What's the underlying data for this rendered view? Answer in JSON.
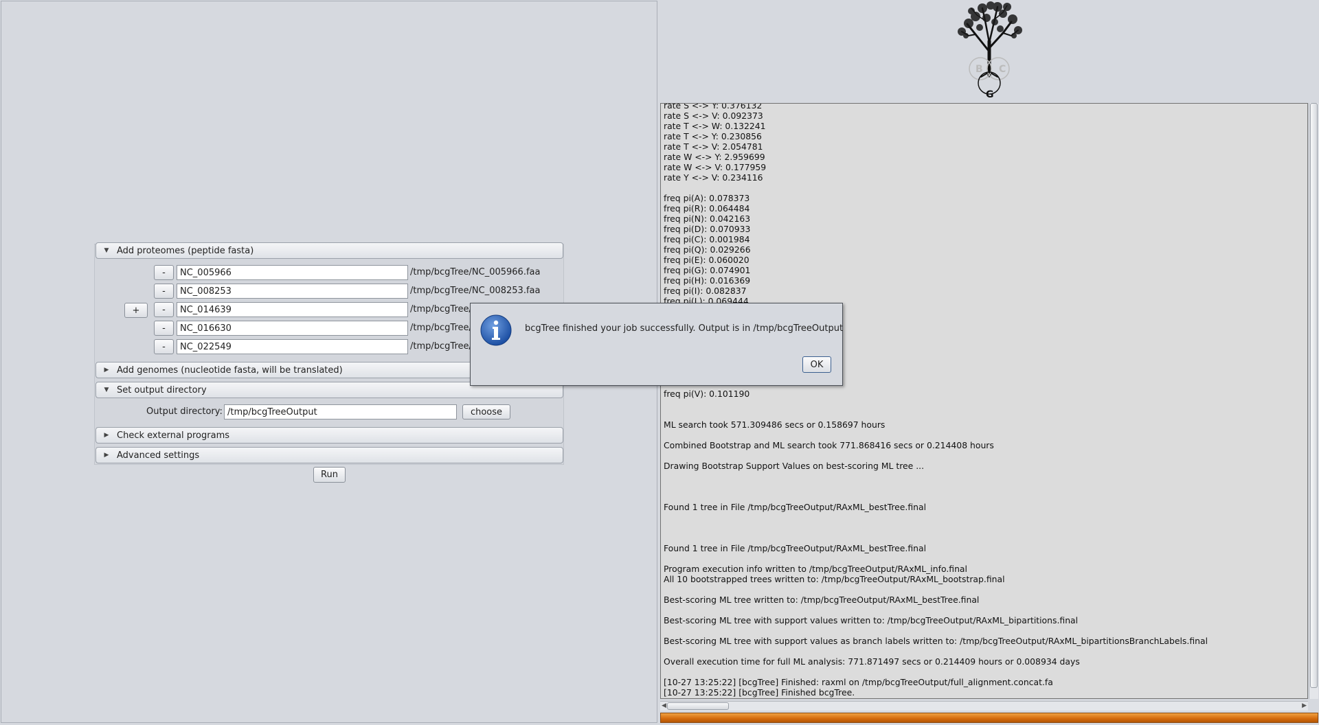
{
  "proteomes": {
    "header": "Add proteomes (peptide fasta)",
    "add_label": "+",
    "remove_label": "-",
    "rows": [
      {
        "name": "NC_005966",
        "path": "/tmp/bcgTree/NC_005966.faa"
      },
      {
        "name": "NC_008253",
        "path": "/tmp/bcgTree/NC_008253.faa"
      },
      {
        "name": "NC_014639",
        "path": "/tmp/bcgTree/"
      },
      {
        "name": "NC_016630",
        "path": "/tmp/bcgTree/"
      },
      {
        "name": "NC_022549",
        "path": "/tmp/bcgTree/"
      }
    ]
  },
  "genomes": {
    "header": "Add genomes (nucleotide fasta, will be translated)"
  },
  "output": {
    "header": "Set output directory",
    "label": "Output directory:",
    "value": "/tmp/bcgTreeOutput",
    "choose_label": "choose"
  },
  "external": {
    "header": "Check external programs"
  },
  "advanced": {
    "header": "Advanced settings"
  },
  "run_label": "Run",
  "dialog": {
    "message": "bcgTree finished your job successfully. Output is in /tmp/bcgTreeOutput",
    "ok_label": "OK"
  },
  "logo": {
    "letters": [
      "B",
      "C",
      "G"
    ]
  },
  "log": {
    "lines": [
      "rate S <-> Y: 0.376132",
      "rate S <-> V: 0.092373",
      "rate T <-> W: 0.132241",
      "rate T <-> Y: 0.230856",
      "rate T <-> V: 2.054781",
      "rate W <-> Y: 2.959699",
      "rate W <-> V: 0.177959",
      "rate Y <-> V: 0.234116",
      "",
      "freq pi(A): 0.078373",
      "freq pi(R): 0.064484",
      "freq pi(N): 0.042163",
      "freq pi(D): 0.070933",
      "freq pi(C): 0.001984",
      "freq pi(Q): 0.029266",
      "freq pi(E): 0.060020",
      "freq pi(G): 0.074901",
      "freq pi(H): 0.016369",
      "freq pi(I): 0.082837",
      "freq pi(L): 0.069444",
      "",
      "",
      "",
      "",
      "",
      "",
      "",
      "",
      "freq pi(V): 0.101190",
      "",
      "",
      "ML search took 571.309486 secs or 0.158697 hours",
      "",
      "Combined Bootstrap and ML search took 771.868416 secs or 0.214408 hours",
      "",
      "Drawing Bootstrap Support Values on best-scoring ML tree ...",
      "",
      "",
      "",
      "Found 1 tree in File /tmp/bcgTreeOutput/RAxML_bestTree.final",
      "",
      "",
      "",
      "Found 1 tree in File /tmp/bcgTreeOutput/RAxML_bestTree.final",
      "",
      "Program execution info written to /tmp/bcgTreeOutput/RAxML_info.final",
      "All 10 bootstrapped trees written to: /tmp/bcgTreeOutput/RAxML_bootstrap.final",
      "",
      "Best-scoring ML tree written to: /tmp/bcgTreeOutput/RAxML_bestTree.final",
      "",
      "Best-scoring ML tree with support values written to: /tmp/bcgTreeOutput/RAxML_bipartitions.final",
      "",
      "Best-scoring ML tree with support values as branch labels written to: /tmp/bcgTreeOutput/RAxML_bipartitionsBranchLabels.final",
      "",
      "Overall execution time for full ML analysis: 771.871497 secs or 0.214409 hours or 0.008934 days",
      "",
      "[10-27 13:25:22] [bcgTree] Finished: raxml on /tmp/bcgTreeOutput/full_alignment.concat.fa",
      "[10-27 13:25:22] [bcgTree] Finished bcgTree."
    ]
  }
}
